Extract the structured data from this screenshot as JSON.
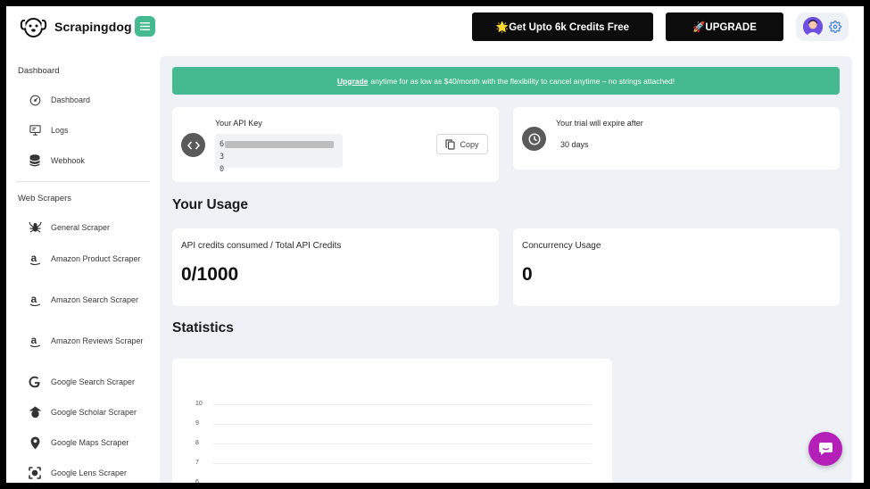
{
  "header": {
    "brand": "Scrapingdog",
    "promo_label": "🌟Get Upto 6k Credits Free",
    "upgrade_label": "🚀UPGRADE"
  },
  "sidebar": {
    "sections": [
      {
        "title": "Dashboard",
        "items": [
          {
            "label": "Dashboard",
            "icon": "gauge-icon"
          },
          {
            "label": "Logs",
            "icon": "monitor-icon"
          },
          {
            "label": "Webhook",
            "icon": "database-icon"
          }
        ]
      },
      {
        "title": "Web Scrapers",
        "items": [
          {
            "label": "General Scraper",
            "icon": "spider-icon"
          },
          {
            "label": "Amazon Product Scraper",
            "icon": "amazon-icon"
          },
          {
            "label": "Amazon Search Scraper",
            "icon": "amazon-icon"
          },
          {
            "label": "Amazon Reviews Scraper",
            "icon": "amazon-icon"
          },
          {
            "label": "Google Search Scraper",
            "icon": "google-icon"
          },
          {
            "label": "Google Scholar Scraper",
            "icon": "scholar-icon"
          },
          {
            "label": "Google Maps Scraper",
            "icon": "map-pin-icon"
          },
          {
            "label": "Google Lens Scraper",
            "icon": "lens-icon"
          }
        ]
      }
    ]
  },
  "banner": {
    "link_text": "Upgrade",
    "text": "anytime for as low as $40/month with the flexibility to cancel anytime – no strings attached!"
  },
  "api_key": {
    "label": "Your API Key",
    "value_start": "6",
    "value_end": "3",
    "value_line2": "0",
    "copy_label": "Copy"
  },
  "trial": {
    "label": "Your trial will expire after",
    "value": "30 days"
  },
  "usage": {
    "heading": "Your Usage",
    "credits_label": "API credits consumed / Total API Credits",
    "credits_value": "0/1000",
    "concurrency_label": "Concurrency Usage",
    "concurrency_value": "0"
  },
  "statistics": {
    "heading": "Statistics"
  },
  "chart_data": {
    "type": "line",
    "title": "",
    "xlabel": "",
    "ylabel": "",
    "y_ticks": [
      "10",
      "9",
      "8",
      "7",
      "6"
    ],
    "ylim": [
      6,
      10
    ],
    "grid": true,
    "series": []
  },
  "colors": {
    "accent": "#45b98f",
    "background": "#eef1f6",
    "chat": "#b41fb8"
  }
}
